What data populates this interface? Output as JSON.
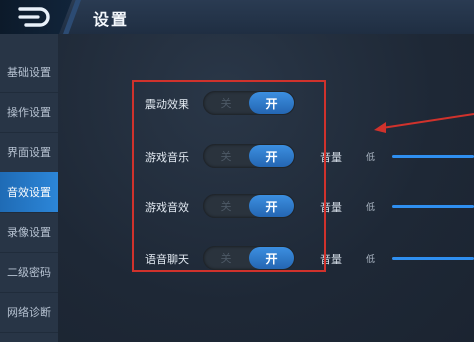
{
  "header": {
    "title": "设置"
  },
  "sidebar": {
    "items": [
      {
        "label": "基础设置"
      },
      {
        "label": "操作设置"
      },
      {
        "label": "界面设置"
      },
      {
        "label": "音效设置"
      },
      {
        "label": "录像设置"
      },
      {
        "label": "二级密码"
      },
      {
        "label": "网络诊断"
      }
    ],
    "active_index": 3
  },
  "settings": {
    "rows": [
      {
        "label": "震动效果",
        "off_label": "关",
        "on_label": "开",
        "state": "on"
      },
      {
        "label": "游戏音乐",
        "off_label": "关",
        "on_label": "开",
        "state": "on",
        "volume_label": "音量",
        "volume_low": "低"
      },
      {
        "label": "游戏音效",
        "off_label": "关",
        "on_label": "开",
        "state": "on",
        "volume_label": "音量",
        "volume_low": "低"
      },
      {
        "label": "语音聊天",
        "off_label": "关",
        "on_label": "开",
        "state": "on",
        "volume_label": "音量",
        "volume_low": "低"
      }
    ]
  },
  "colors": {
    "accent": "#2c86d8",
    "annotation": "#d0322c"
  },
  "icons": {
    "back": "back-arrow-icon",
    "annotation_arrow": "red-arrow-icon"
  }
}
